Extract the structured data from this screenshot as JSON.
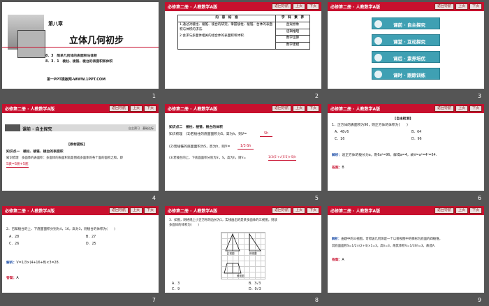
{
  "header": {
    "title": "必修第二册 · 人教数学A版",
    "btn_nav": "返回导航",
    "btn_prev": "上页",
    "btn_next": "下页"
  },
  "slides": [
    {
      "num": "1",
      "chapter": "第八章",
      "title": "立体几何初步",
      "sub1": "8．3　简单几何体的表面积与体积",
      "sub2": "8．3．1　棱柱、棱锥、棱台的表面积和体积",
      "footer": "第一PPT模板网-WWW.1PPT.COM"
    },
    {
      "num": "2",
      "h1": "内　容　标　准",
      "h2": "学　科　素　养",
      "c1": "1.通过对棱柱、棱锥、棱台的研究，掌握棱柱、棱锥、台体的表面积与体积的求法.",
      "c2": "2.会求与多面体相关的组合体的表面积和体积.",
      "skills": [
        "直观想象",
        "逻辑推理",
        "数学运算",
        "数学建模"
      ]
    },
    {
      "num": "3",
      "menu": [
        "课前 · 自主探究",
        "课堂 · 互动探究",
        "课后 · 素养培优",
        "课时 · 跟踪训练"
      ]
    },
    {
      "num": "4",
      "sec": "课前 · 自主探究",
      "sec_right": "自主预习　基础达标",
      "tag": "[教材提炼]",
      "kp": "知识点一　棱柱、棱锥、棱台的表面积",
      "l1": "知识梳理　多面体的表面积：多面体的表面积就是围成多面体的各个面的面积之和，即",
      "l2": "S表=S侧+S底"
    },
    {
      "num": "5",
      "kp": "知识点二　棱柱、棱锥、棱台的体积",
      "l1": "知识梳理　(1)若棱柱的底面面积为S，高为h，则V=",
      "a1": "Sh",
      "l2": "(2)若棱锥的底面面积为S，高为h，则V=",
      "a2": "1/3·Sh",
      "l3": "(3)若棱台的上、下底面面积分别为S′，S，高为h，则V=",
      "a3": "1/3(S′+√(S′S)+S)h"
    },
    {
      "num": "6",
      "tag": "[自主检测]",
      "q": "1．正方体的表面积为96，则正方体的体积为(　　)",
      "A": "A．48√6",
      "B": "B．64",
      "C": "C．16",
      "D": "D．96",
      "jx_label": "解析：",
      "jx": "设正方体的棱长为a，则6a²=96，解得a=4，故V=a³=4³=64.",
      "da_label": "答案：",
      "da": "B"
    },
    {
      "num": "7",
      "q": "2．已知棱台的上、下底面面积分别为4，16，高为3，则棱台的体积为(　　)",
      "A": "A．28",
      "B": "B．27",
      "C": "C．26",
      "D": "D．25",
      "jx_label": "解析：",
      "jx": "V=1/3×(4+16+8)×3=28.",
      "da_label": "答案：",
      "da": "A"
    },
    {
      "num": "8",
      "q": "3．如图，网格纸上小正方形的边长为1，实线画出的是某多面体的三视图，则该",
      "q2": "多面体的体积为(　　)",
      "labels": [
        "正视图",
        "侧视图",
        "俯视图"
      ],
      "A": "A．3",
      "B": "B．3√3",
      "C": "C．9",
      "D": "D．9√3"
    },
    {
      "num": "9",
      "jx_label": "解析：",
      "jx": "由题中的三视图，可得该几何体是一个以俯视图中的梯形为底面的四棱锥，",
      "jx2": "其底面面积S=1/2×(2+4)×1=3，高h=3，故其体积V=1/3Sh=3，故选A.",
      "da_label": "答案：",
      "da": "A"
    }
  ]
}
